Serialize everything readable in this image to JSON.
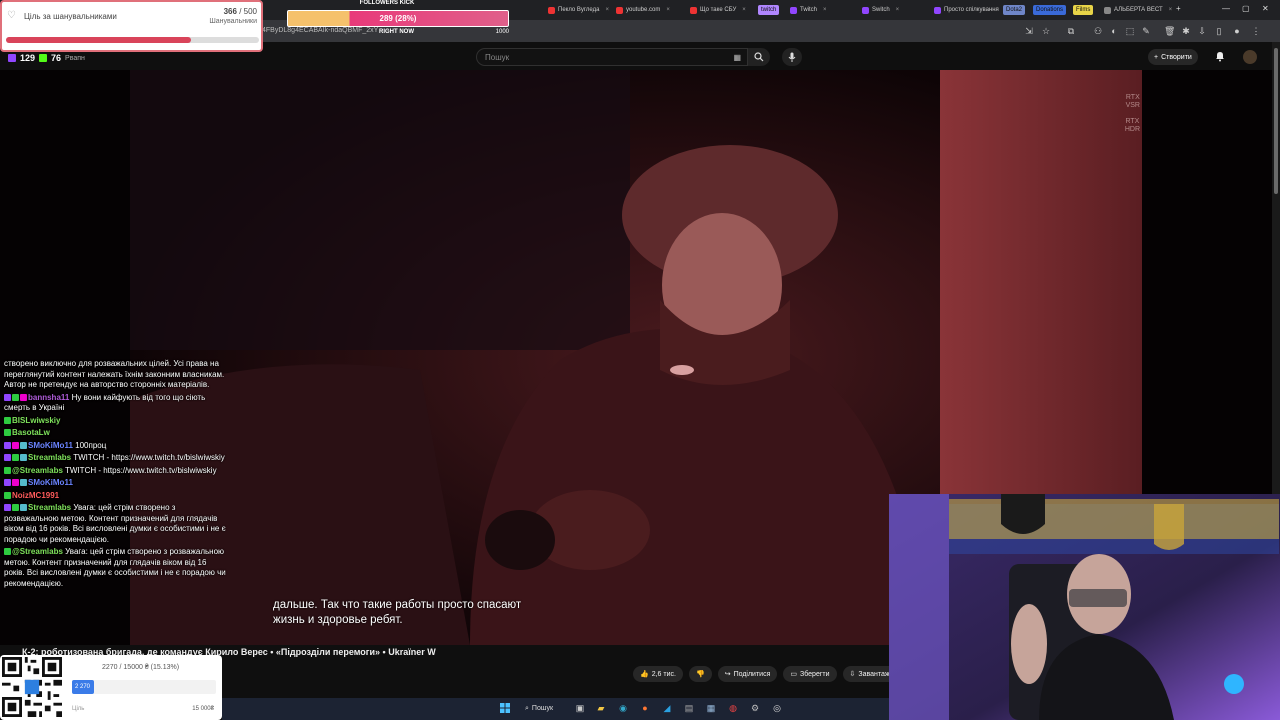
{
  "browser": {
    "address": "4FByDL8g4ECABAIk-ndaQBMF_2xY",
    "tabs": [
      {
        "label": "Пекло Вугледа",
        "color": "#e33"
      },
      {
        "label": "youtube.com",
        "color": "#e33"
      },
      {
        "label": "Що таке СБУ",
        "color": "#e33"
      },
      {
        "label": "Twitch",
        "color": "#9146ff"
      },
      {
        "label": "Switch",
        "color": "#9146ff"
      },
      {
        "label": "Просто спілкування",
        "color": "#9146ff"
      },
      {
        "label": "АЛЬБЕРТА ВЕСТ",
        "color": "#888"
      }
    ],
    "chips": [
      "twitch",
      "Dota2",
      "Donations",
      "Films"
    ]
  },
  "youtube": {
    "search_placeholder": "Пошук",
    "create_label": "Створити",
    "video": {
      "rtx_vsr": [
        "RTX",
        "VSR"
      ],
      "rtx_hdr": [
        "RTX",
        "HDR"
      ],
      "subtitle_lines": [
        "дальше. Так что такие работы просто спасают",
        "жизнь и здоровье ребят."
      ],
      "title": "К-2: роботизована бригада, де командує Кирило Верес • «Підрозділи перемоги» • Ukraїner W",
      "likes": "2,6 тис.",
      "share": "Поділитися",
      "save": "Зберегти",
      "download": "Завантажити"
    }
  },
  "overlays": {
    "followers_goal": {
      "title": "Ціль за шанувальниками",
      "count": "366",
      "total": "500",
      "subtitle": "Шанувальники",
      "progress": 0.732
    },
    "kick": {
      "header": "FOLLOWERS KICK",
      "percent_text": "289 (28%)",
      "progress": 0.289,
      "label_mid": "RIGHT NOW",
      "label_right": "1000"
    },
    "viewers": {
      "twitch": "129",
      "kick": "76",
      "extra": "Рвапн"
    },
    "chat": [
      {
        "name": "",
        "name_color": "#fff",
        "text": "створено виключно для розважальних цілей. Усі права на переглянутий контент належать їхнім законним власникам. Автор не претендує на авторство сторонніх матеріалів.",
        "badges": []
      },
      {
        "name": "bannsha11",
        "name_color": "#b05bd8",
        "text": "Ну вони кайфують від того що сіють смерть в Україні",
        "badges": [
          "#9146ff",
          "#2ecc40",
          "#e0c"
        ]
      },
      {
        "name": "BISLwiwskiy",
        "name_color": "#7fe15b",
        "text": "",
        "badges": [
          "#2ecc40"
        ]
      },
      {
        "name": "BasotaLw",
        "name_color": "#7fe15b",
        "text": "",
        "badges": [
          "#2ecc40"
        ]
      },
      {
        "name": "SMoKiMo11",
        "name_color": "#6b83ff",
        "text": "100проц",
        "badges": [
          "#9146ff",
          "#e0c",
          "#5bc"
        ]
      },
      {
        "name": "Streamlabs",
        "name_color": "#7fe15b",
        "text": "TWITCH - https://www.twitch.tv/bislwiwskiy",
        "badges": [
          "#9146ff",
          "#2ecc40",
          "#5bc"
        ]
      },
      {
        "name": "@Streamlabs",
        "name_color": "#7fe15b",
        "text": "TWITCH - https://www.twitch.tv/bislwiwskiy",
        "badges": [
          "#2ecc40"
        ]
      },
      {
        "name": "SMoKiMo11",
        "name_color": "#6b83ff",
        "text": "",
        "badges": [
          "#9146ff",
          "#e0c",
          "#5bc"
        ]
      },
      {
        "name": "NoizMC1991",
        "name_color": "#ff5b5b",
        "text": "",
        "badges": [
          "#2ecc40"
        ]
      },
      {
        "name": "Streamlabs",
        "name_color": "#7fe15b",
        "text": "Увага: цей стрім створено з розважальною метою. Контент призначений для глядачів віком від 16 років. Всі висловлені думки є особистими і не є порадою чи рекомендацією.",
        "badges": [
          "#9146ff",
          "#2ecc40",
          "#5bc"
        ]
      },
      {
        "name": "@Streamlabs",
        "name_color": "#7fe15b",
        "text": "Увага: цей стрім створено з розважальною метою. Контент призначений для глядачів віком від 16 років. Всі висловлені думки є особистими і не є порадою чи рекомендацією.",
        "badges": [
          "#2ecc40"
        ]
      }
    ],
    "donation_goal": {
      "text": "2270 / 15000 ₴ (15.13%)",
      "fill_label": "2 270",
      "progress": 0.1513,
      "left_label": "Ціль",
      "right_label": "15 000₴"
    }
  },
  "taskbar": {
    "search_label": "Пошук"
  }
}
